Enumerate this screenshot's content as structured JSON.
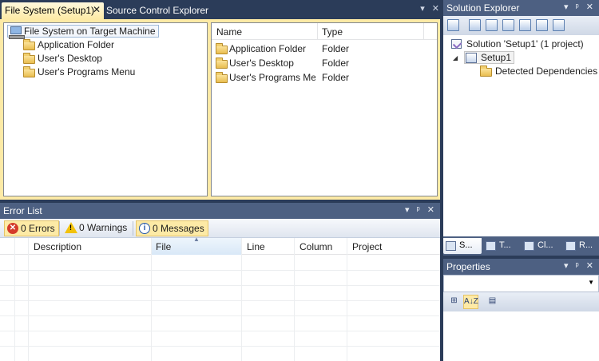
{
  "doc_tabs": {
    "active": {
      "label": "File System (Setup1)",
      "close": "✕"
    },
    "inactive": {
      "label": "Source Control Explorer"
    },
    "strip_controls": [
      "▾",
      "✕"
    ]
  },
  "file_system": {
    "tree": {
      "root": "File System on Target Machine",
      "items": [
        "Application Folder",
        "User's Desktop",
        "User's Programs Menu"
      ]
    },
    "list": {
      "columns": [
        "Name",
        "Type"
      ],
      "rows": [
        {
          "name": "Application Folder",
          "type": "Folder"
        },
        {
          "name": "User's Desktop",
          "type": "Folder"
        },
        {
          "name": "User's Programs Me...",
          "type": "Folder"
        }
      ]
    }
  },
  "error_list": {
    "title": "Error List",
    "controls": "▾ ᵖ ✕",
    "filters": {
      "errors": "0 Errors",
      "warnings": "0 Warnings",
      "messages": "0 Messages"
    },
    "columns": [
      "Description",
      "File",
      "Line",
      "Column",
      "Project"
    ]
  },
  "solution_explorer": {
    "title": "Solution Explorer",
    "controls": "▾ ᵖ ✕",
    "nodes": {
      "solution": "Solution 'Setup1' (1 project)",
      "project": "Setup1",
      "dependencies": "Detected Dependencies"
    },
    "tabs": [
      "S...",
      "T...",
      "Cl...",
      "R..."
    ]
  },
  "properties": {
    "title": "Properties",
    "controls": "▾ ᵖ ✕",
    "sort_categorized": "⊞",
    "sort_alpha": "A↓Z"
  },
  "colors": {
    "chrome": "#2b3c59",
    "tool_header": "#4d6082",
    "active_tab": "#fdeaa6"
  }
}
